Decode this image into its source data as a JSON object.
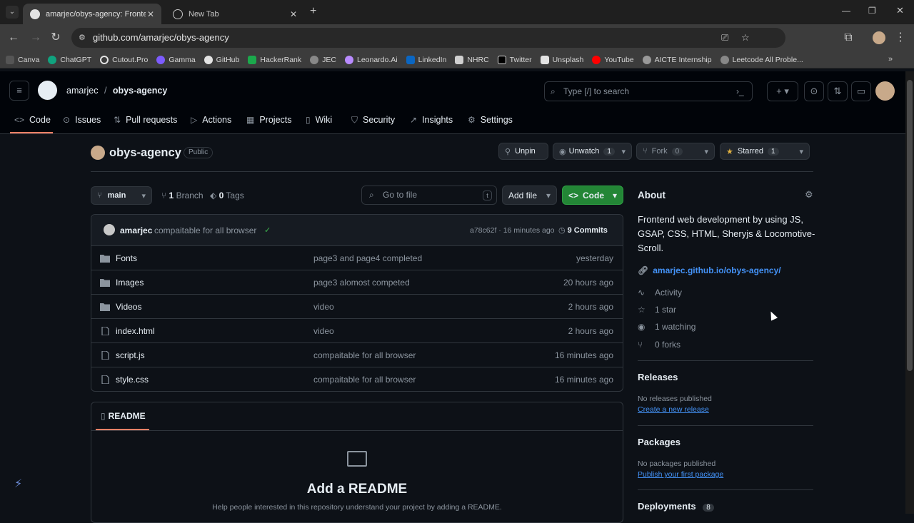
{
  "browser": {
    "tabs": [
      {
        "label": "amarjec/obys-agency: Frontend"
      },
      {
        "label": "New Tab"
      }
    ],
    "url": "github.com/amarjec/obys-agency",
    "bookmarks": [
      "Canva",
      "ChatGPT",
      "Cutout.Pro",
      "Gamma",
      "GitHub",
      "HackerRank",
      "JEC",
      "Leonardo.Ai",
      "LinkedIn",
      "NHRC",
      "Twitter",
      "Unsplash",
      "YouTube",
      "AICTE Internship",
      "Leetcode All Proble..."
    ]
  },
  "header": {
    "owner": "amarjec",
    "sep": "/",
    "repo": "obys-agency",
    "search_placeholder": "Type [/] to search"
  },
  "nav": [
    "Code",
    "Issues",
    "Pull requests",
    "Actions",
    "Projects",
    "Wiki",
    "Security",
    "Insights",
    "Settings"
  ],
  "repo": {
    "name": "obys-agency",
    "visibility": "Public",
    "unpin": "Unpin",
    "unwatch": "Unwatch",
    "watch_count": "1",
    "fork": "Fork",
    "fork_count": "0",
    "starred": "Starred",
    "star_count": "1"
  },
  "branchbar": {
    "branch": "main",
    "branches_count": "1",
    "branches_label": "Branch",
    "tags_count": "0",
    "tags_label": "Tags",
    "goto_file": "Go to file",
    "goto_key": "t",
    "add_file": "Add file",
    "code": "Code"
  },
  "commit": {
    "author": "amarjec",
    "message": "compaitable for all browser",
    "check": "✓",
    "hash": "a78c62f",
    "sep": "·",
    "time": "16 minutes ago",
    "commits": "9 Commits"
  },
  "files": [
    {
      "name": "Fonts",
      "type": "dir",
      "msg": "page3 and page4 completed",
      "time": "yesterday"
    },
    {
      "name": "Images",
      "type": "dir",
      "msg": "page3 alomost competed",
      "time": "20 hours ago"
    },
    {
      "name": "Videos",
      "type": "dir",
      "msg": "video",
      "time": "2 hours ago"
    },
    {
      "name": "index.html",
      "type": "file",
      "msg": "video",
      "time": "2 hours ago"
    },
    {
      "name": "script.js",
      "type": "file",
      "msg": "compaitable for all browser",
      "time": "16 minutes ago"
    },
    {
      "name": "style.css",
      "type": "file",
      "msg": "compaitable for all browser",
      "time": "16 minutes ago"
    }
  ],
  "readme": {
    "tab": "README",
    "title": "Add a README",
    "subtitle": "Help people interested in this repository understand your project by adding a README."
  },
  "about": {
    "title": "About",
    "description": "Frontend web development by using JS, GSAP, CSS, HTML, Sheryjs & Locomotive-Scroll.",
    "link": "amarjec.github.io/obys-agency/",
    "activity": "Activity",
    "stars": "1 star",
    "watching": "1 watching",
    "forks": "0 forks"
  },
  "releases": {
    "title": "Releases",
    "none": "No releases published",
    "create": "Create a new release"
  },
  "packages": {
    "title": "Packages",
    "none": "No packages published",
    "publish": "Publish your first package"
  },
  "deployments": {
    "title": "Deployments",
    "count": "8"
  },
  "colors": {
    "accent_green": "#238636",
    "link_blue": "#4493f8",
    "active_tab": "#f78166"
  }
}
